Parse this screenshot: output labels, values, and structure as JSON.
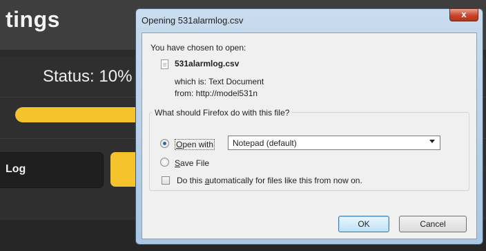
{
  "background": {
    "title": "tings",
    "status": "Status: 10%",
    "log_button": "Log",
    "progress_fraction": 0.1
  },
  "dialog": {
    "title": "Opening 531alarmlog.csv",
    "close_symbol": "x",
    "chosen_label": "You have chosen to open:",
    "file_name": "531alarmlog.csv",
    "which_is": "which is:  Text Document",
    "from": "from:  http://model531n",
    "question": "What should Firefox do with this file?",
    "open_with": {
      "underlined": "O",
      "rest": "pen with",
      "selected": true
    },
    "app_select": {
      "value": "Notepad (default)"
    },
    "save_file": {
      "underlined": "S",
      "rest": "ave File",
      "selected": false
    },
    "auto": {
      "before": "Do this ",
      "underlined": "a",
      "after": "utomatically for files like this from now on.",
      "checked": false
    },
    "ok_label": "OK",
    "cancel_label": "Cancel"
  },
  "colors": {
    "accent_yellow": "#f5c22b",
    "app_dark": "#2f2f2f",
    "titlebar_blue": "#c9dcef",
    "close_red": "#c8452c"
  }
}
